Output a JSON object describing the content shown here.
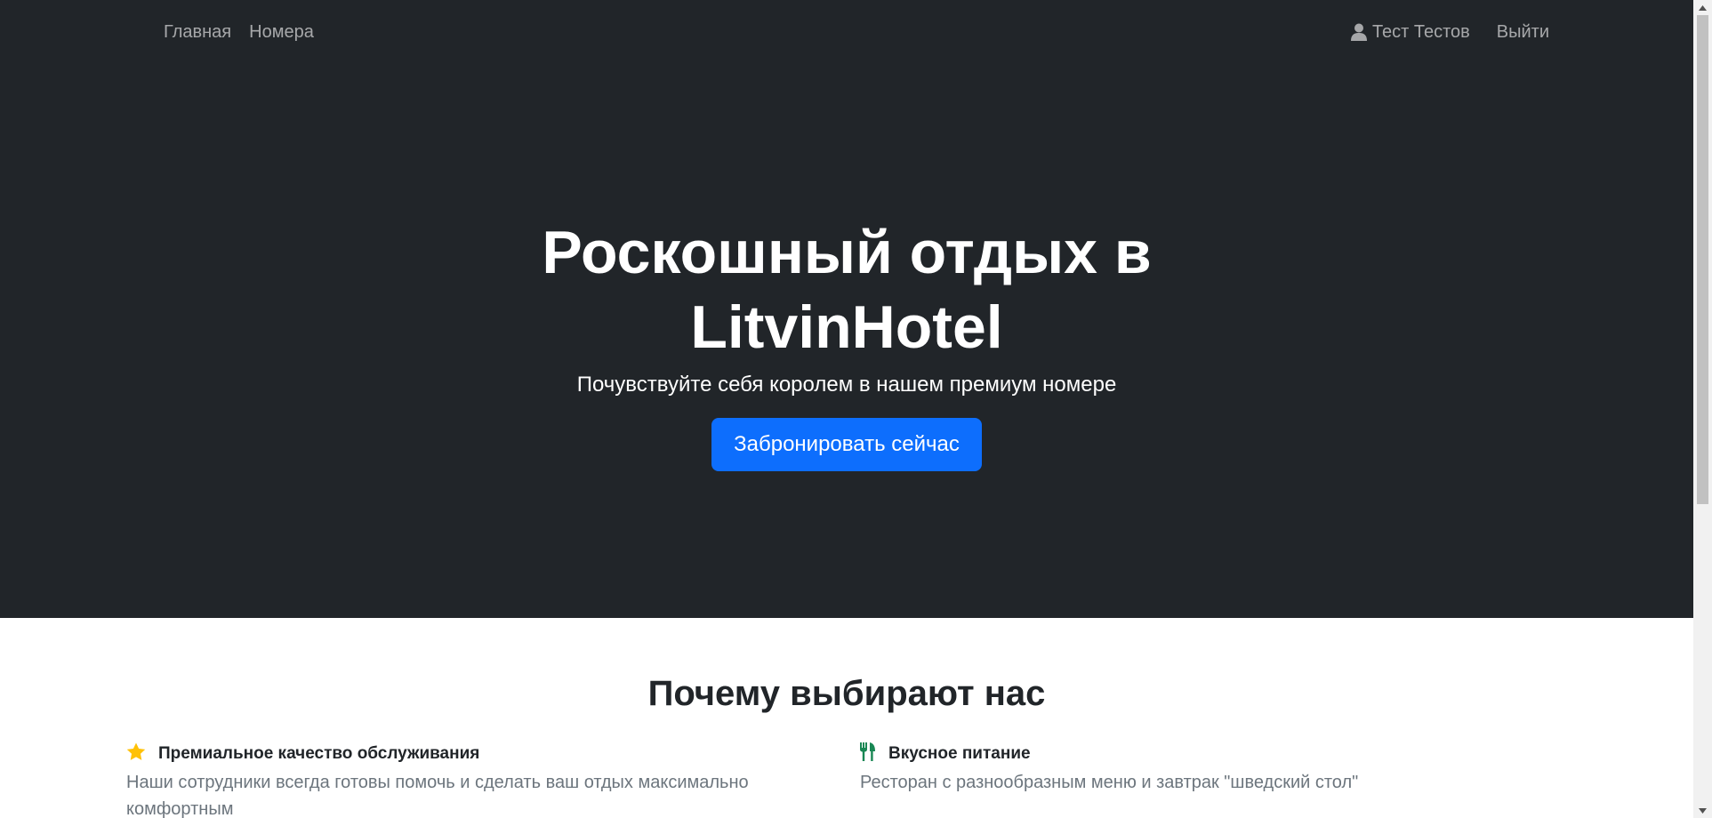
{
  "nav": {
    "links": [
      {
        "label": "Главная"
      },
      {
        "label": "Номера"
      }
    ],
    "user_name": "Тест Тестов",
    "logout_label": "Выйти"
  },
  "hero": {
    "title_line1": "Роскошный отдых в",
    "title_line2": "LitvinHotel",
    "subtitle": "Почувствуйте себя королем в нашем премиум номере",
    "cta_label": "Забронировать сейчас"
  },
  "features": {
    "title": "Почему выбирают нас",
    "items": [
      {
        "icon": "star-icon",
        "title": "Премиальное качество обслуживания",
        "description": "Наши сотрудники всегда готовы помочь и сделать ваш отдых максимально комфортным",
        "icon_color": "#ffc107"
      },
      {
        "icon": "utensils-icon",
        "title": "Вкусное питание",
        "description": "Ресторан с разнообразным меню и завтрак \"шведский стол\"",
        "icon_color": "#198754"
      }
    ]
  },
  "colors": {
    "dark_bg": "#212529",
    "primary": "#0d6efd",
    "muted_text": "#6c757d"
  }
}
